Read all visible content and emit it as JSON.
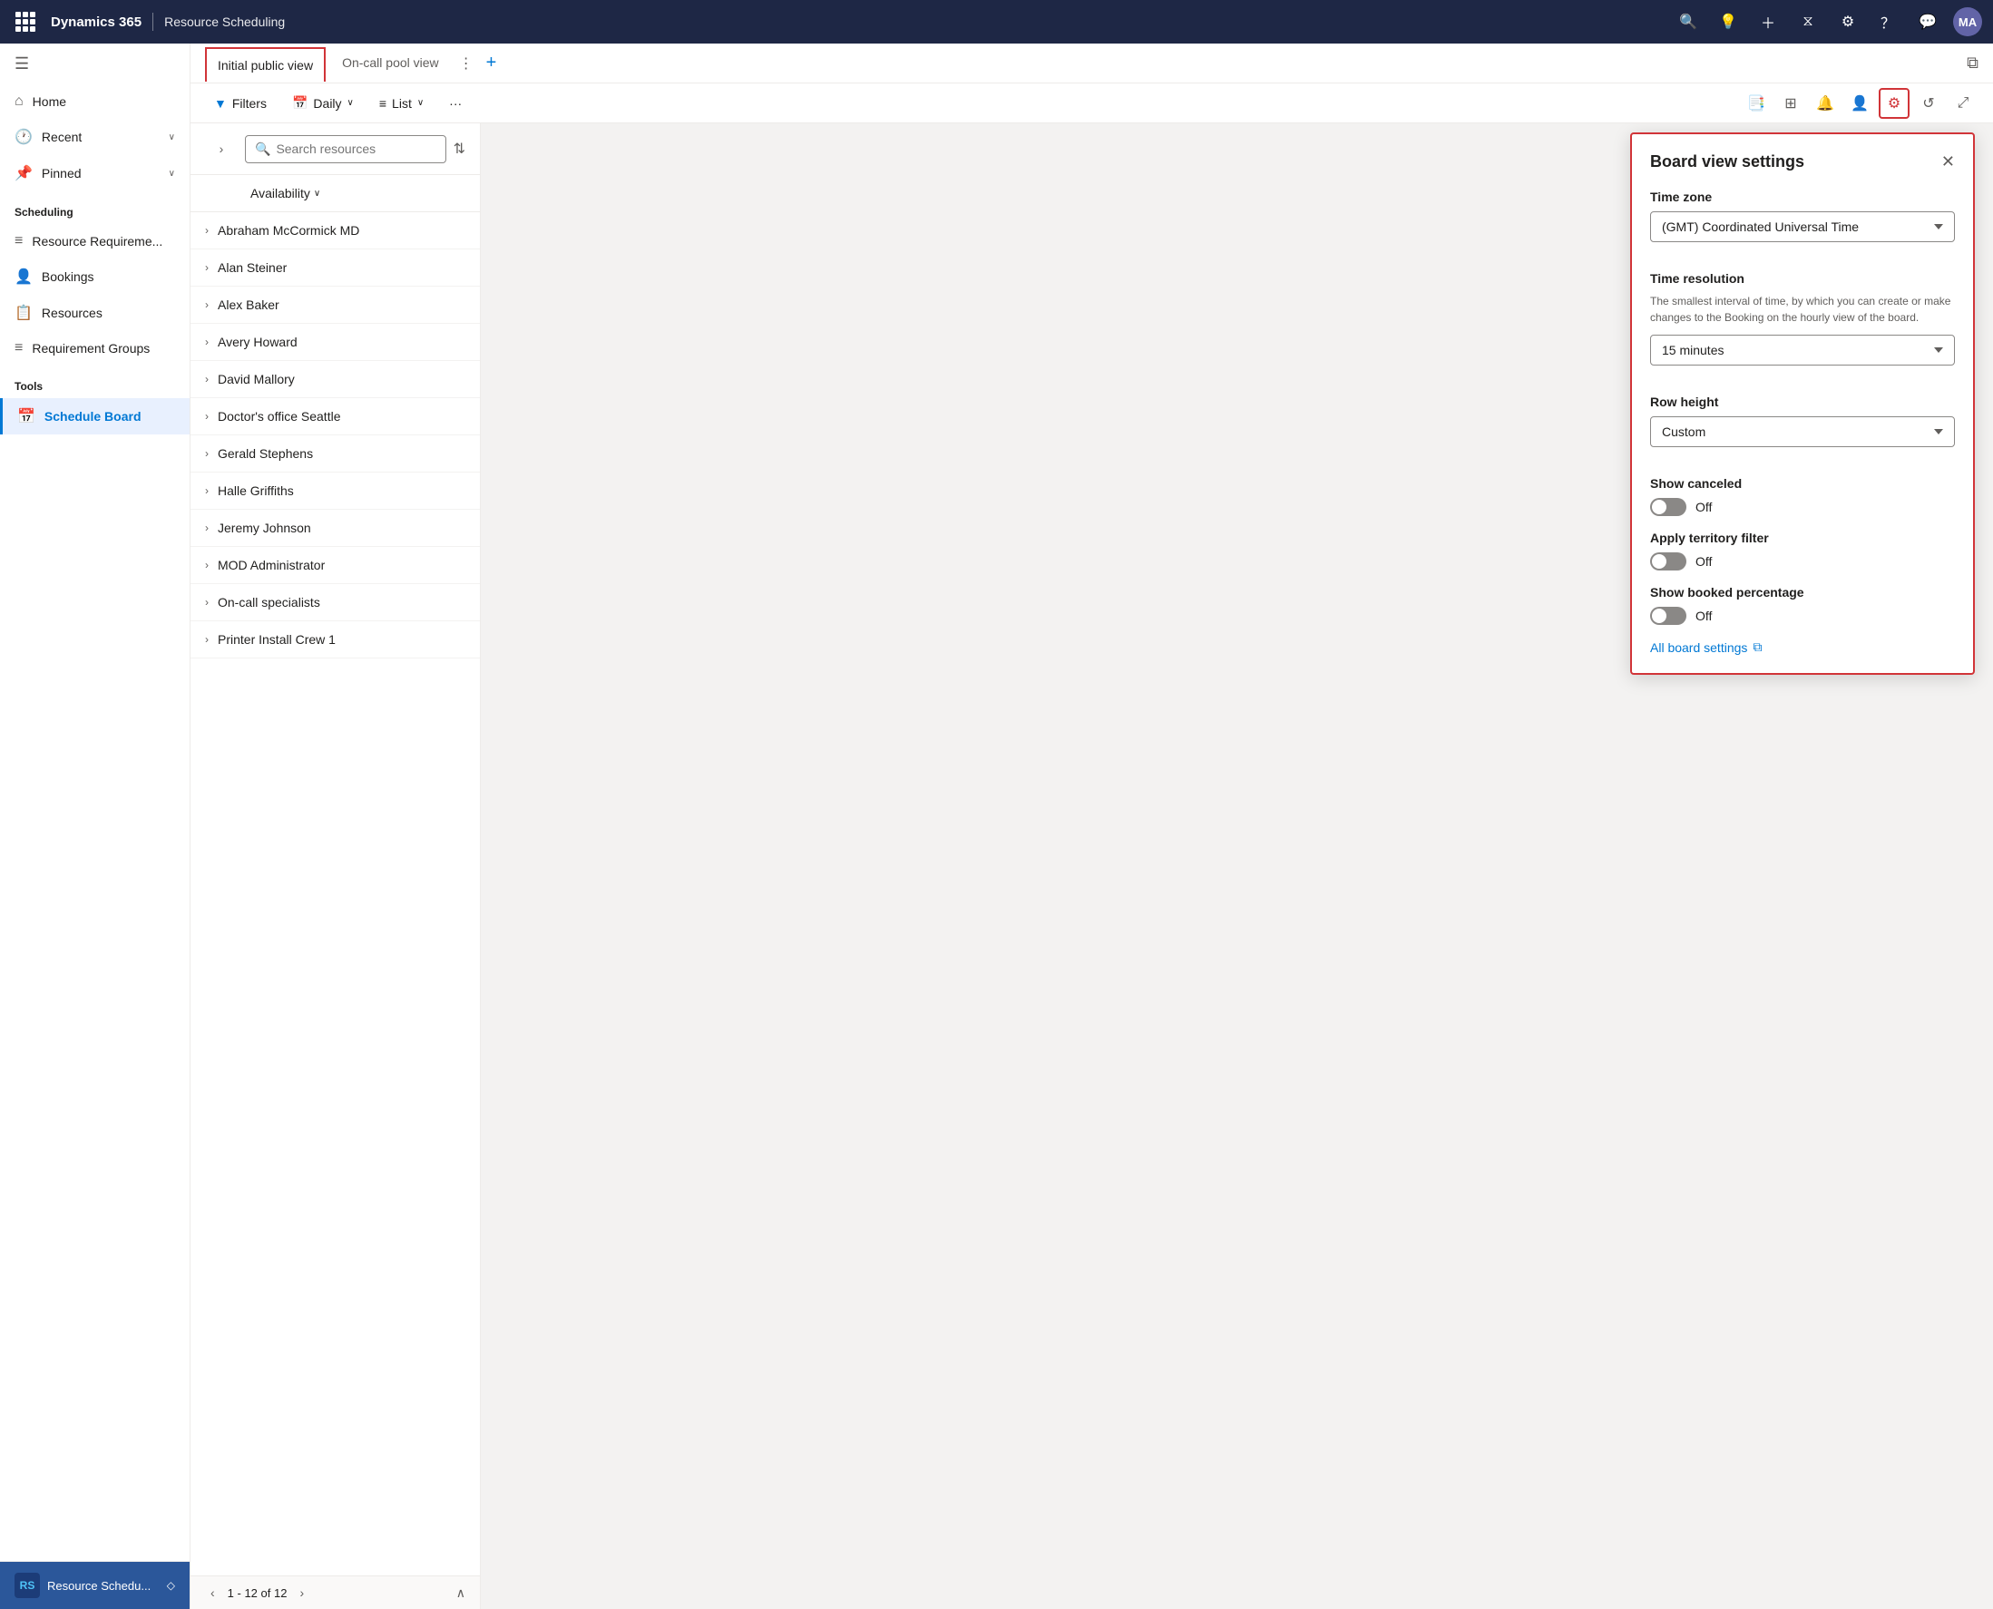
{
  "topbar": {
    "brand": "Dynamics 365",
    "module": "Resource Scheduling",
    "avatar": "MA",
    "icons": [
      "search",
      "lightbulb",
      "plus",
      "filter",
      "settings",
      "help",
      "chat"
    ]
  },
  "sidebar": {
    "nav_items": [
      {
        "id": "home",
        "label": "Home",
        "icon": "⌂"
      },
      {
        "id": "recent",
        "label": "Recent",
        "icon": "🕐",
        "has_chevron": true
      },
      {
        "id": "pinned",
        "label": "Pinned",
        "icon": "📌",
        "has_chevron": true
      }
    ],
    "scheduling_label": "Scheduling",
    "scheduling_items": [
      {
        "id": "resource-req",
        "label": "Resource Requireme...",
        "icon": "≡"
      },
      {
        "id": "bookings",
        "label": "Bookings",
        "icon": "👤"
      },
      {
        "id": "resources",
        "label": "Resources",
        "icon": "📋"
      },
      {
        "id": "req-groups",
        "label": "Requirement Groups",
        "icon": "≡"
      }
    ],
    "tools_label": "Tools",
    "tools_items": [
      {
        "id": "schedule-board",
        "label": "Schedule Board",
        "icon": "📅",
        "active": true
      }
    ],
    "bottom_icon": "RS",
    "bottom_text": "Resource Schedu...",
    "bottom_chevron": "◇"
  },
  "tabs": {
    "active_tab": "Initial public view",
    "other_tabs": [
      "On-call pool view"
    ],
    "add_label": "+"
  },
  "toolbar": {
    "filters_label": "Filters",
    "daily_label": "Daily",
    "list_label": "List",
    "more_label": "···",
    "right_icons": [
      "bookmark",
      "list-detail",
      "bell",
      "person",
      "settings",
      "refresh",
      "expand"
    ]
  },
  "resource_search": {
    "placeholder": "Search resources",
    "availability_label": "Availability"
  },
  "resources": [
    {
      "name": "Abraham McCormick MD"
    },
    {
      "name": "Alan Steiner"
    },
    {
      "name": "Alex Baker"
    },
    {
      "name": "Avery Howard"
    },
    {
      "name": "David Mallory"
    },
    {
      "name": "Doctor's office Seattle"
    },
    {
      "name": "Gerald Stephens"
    },
    {
      "name": "Halle Griffiths"
    },
    {
      "name": "Jeremy Johnson"
    },
    {
      "name": "MOD Administrator"
    },
    {
      "name": "On-call specialists"
    },
    {
      "name": "Printer Install Crew 1"
    }
  ],
  "pagination": {
    "current": "1 - 12 of 12"
  },
  "board_settings": {
    "title": "Board view settings",
    "time_zone_label": "Time zone",
    "time_zone_value": "(GMT) Coordinated Universal Time",
    "time_resolution_label": "Time resolution",
    "time_resolution_description": "The smallest interval of time, by which you can create or make changes to the Booking on the hourly view of the board.",
    "time_resolution_value": "15 minutes",
    "row_height_label": "Row height",
    "row_height_value": "Custom",
    "show_canceled_label": "Show canceled",
    "show_canceled_value": "Off",
    "apply_territory_label": "Apply territory filter",
    "apply_territory_value": "Off",
    "show_booked_label": "Show booked percentage",
    "show_booked_value": "Off",
    "all_settings_link": "All board settings"
  }
}
